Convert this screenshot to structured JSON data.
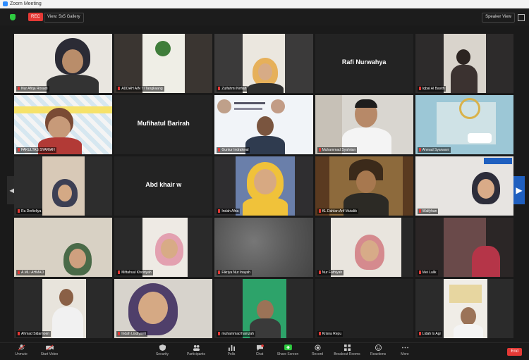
{
  "window": {
    "title": "Zoom Meeting"
  },
  "topbar": {
    "rec": "REC",
    "view": "View: 5x5 Gallery",
    "speaker_view": "Speaker View"
  },
  "tiles": [
    {
      "name": "Nur Afiqa Rosadi",
      "label": ""
    },
    {
      "name": "ADDAH AIN TI Tangkaang",
      "label": ""
    },
    {
      "name": "Zulfahmi Nirfiah",
      "label": ""
    },
    {
      "name": "",
      "label": "Rafi Nurwahya"
    },
    {
      "name": "Iqbal Al Basith",
      "label": ""
    },
    {
      "name": "FAKULTAS SYARIAH",
      "label": ""
    },
    {
      "name": "",
      "label": "Mufihatul Barirah"
    },
    {
      "name": "Guntur Indrakwal",
      "label": ""
    },
    {
      "name": "Muhammad Syahrian",
      "label": ""
    },
    {
      "name": "Ahmad Syarwani",
      "label": ""
    },
    {
      "name": "Ra Derlieliya",
      "label": ""
    },
    {
      "name": "",
      "label": "Abd khair w"
    },
    {
      "name": "Indah Afria",
      "label": ""
    },
    {
      "name": "KL Dahlan Arif Mutalib",
      "label": ""
    },
    {
      "name": "Walfyhan",
      "label": ""
    },
    {
      "name": "A.MLI AHMAD",
      "label": ""
    },
    {
      "name": "Miftahuul Khoiriyah",
      "label": ""
    },
    {
      "name": "Fikriya Nur Inayah",
      "label": ""
    },
    {
      "name": "Nur Fathiyah",
      "label": ""
    },
    {
      "name": "Mei Lalik",
      "label": ""
    },
    {
      "name": "Ahmad Sidarnoen",
      "label": ""
    },
    {
      "name": "Indah Lisdiyanti",
      "label": ""
    },
    {
      "name": "muhammad hamzah",
      "label": ""
    },
    {
      "name": "Krisna Repu",
      "label": ""
    },
    {
      "name": "Lidah Is Agr",
      "label": ""
    }
  ],
  "toolbar": {
    "items": [
      {
        "label": "Unmute",
        "icon": "microphone-icon"
      },
      {
        "label": "Start Video",
        "icon": "video-camera-icon"
      },
      {
        "label": "Security",
        "icon": "shield-icon"
      },
      {
        "label": "Participants",
        "icon": "participants-icon"
      },
      {
        "label": "Polls",
        "icon": "polls-icon"
      },
      {
        "label": "Chat",
        "icon": "chat-icon"
      },
      {
        "label": "Share Screen",
        "icon": "share-screen-icon"
      },
      {
        "label": "Record",
        "icon": "record-icon"
      },
      {
        "label": "Breakout Rooms",
        "icon": "breakout-rooms-icon"
      },
      {
        "label": "Reactions",
        "icon": "reactions-icon"
      },
      {
        "label": "More",
        "icon": "more-icon"
      }
    ],
    "end": "End"
  },
  "colors": {
    "accent": "#2d8cff",
    "end": "#e53935",
    "share": "#2ecc40"
  }
}
